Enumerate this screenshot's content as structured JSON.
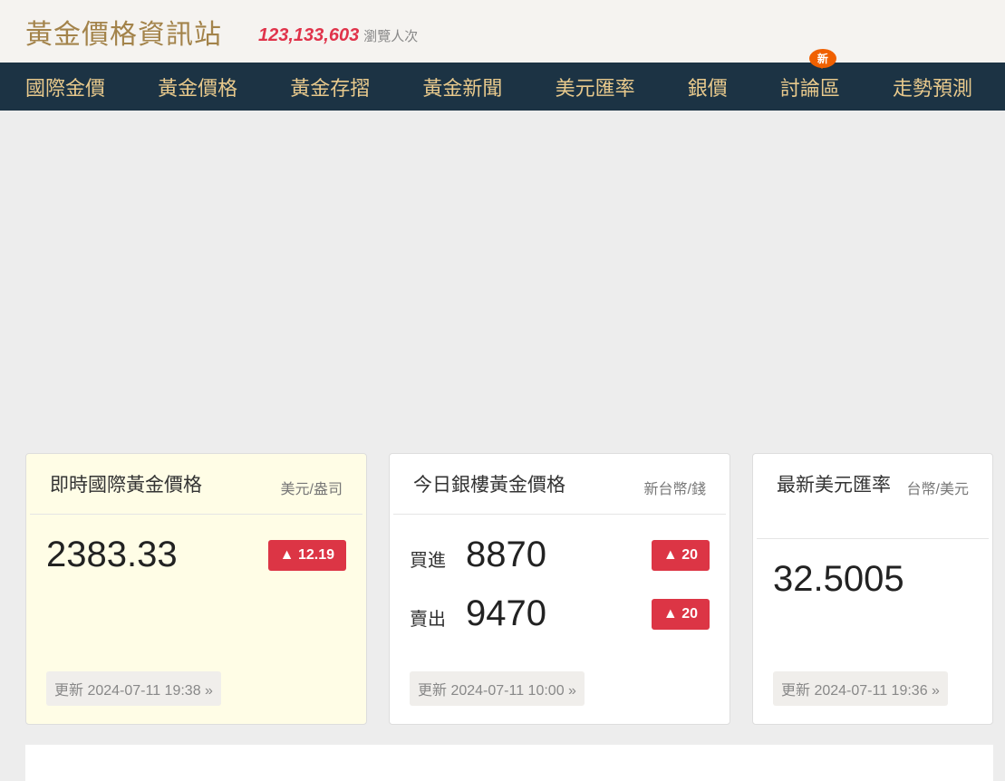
{
  "header": {
    "title": "黃金價格資訊站",
    "count": "123,133,603",
    "count_label": "瀏覽人次"
  },
  "nav": [
    {
      "label": "國際金價"
    },
    {
      "label": "黃金價格"
    },
    {
      "label": "黃金存摺"
    },
    {
      "label": "黃金新聞"
    },
    {
      "label": "美元匯率"
    },
    {
      "label": "銀價"
    },
    {
      "label": "討論區",
      "badge": "新"
    },
    {
      "label": "走勢預測"
    }
  ],
  "cards": {
    "intl": {
      "title": "即時國際黃金價格",
      "unit": "美元/盎司",
      "price": "2383.33",
      "change": "▲ 12.19",
      "updated": "更新 2024-07-11 19:38 »"
    },
    "bank": {
      "title": "今日銀樓黃金價格",
      "unit": "新台幣/錢",
      "buy_label": "買進",
      "buy": "8870",
      "buy_change": "▲ 20",
      "sell_label": "賣出",
      "sell": "9470",
      "sell_change": "▲ 20",
      "updated": "更新 2024-07-11 10:00 »"
    },
    "fx": {
      "title": "最新美元匯率",
      "unit": "台幣/美元",
      "rate": "32.5005",
      "updated": "更新 2024-07-11 19:36 »"
    }
  }
}
